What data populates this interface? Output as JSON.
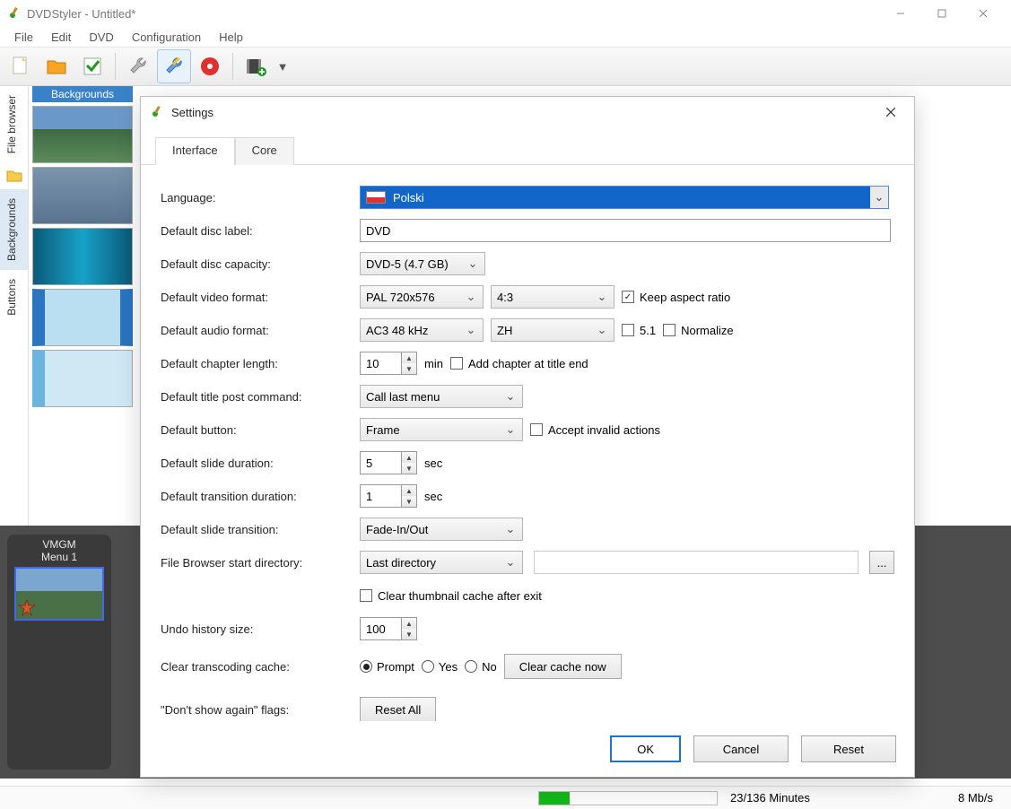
{
  "window": {
    "title": "DVDStyler - Untitled*"
  },
  "menubar": [
    "File",
    "Edit",
    "DVD",
    "Configuration",
    "Help"
  ],
  "toolbar_icons": [
    "new",
    "open",
    "save",
    "settings",
    "options",
    "burn",
    "sep",
    "add",
    "drop"
  ],
  "side_tabs": {
    "file_browser": "File browser",
    "backgrounds": "Backgrounds",
    "buttons": "Buttons"
  },
  "thumbs_header": "Backgrounds",
  "timeline": {
    "vmgm": "VMGM",
    "menu1": "Menu 1"
  },
  "status": {
    "minutes": "23/136 Minutes",
    "rate": "8 Mb/s",
    "progress_pct": 17
  },
  "dialog": {
    "title": "Settings",
    "tabs": {
      "interface": "Interface",
      "core": "Core"
    },
    "labels": {
      "language": "Language:",
      "disc_label": "Default disc label:",
      "disc_capacity": "Default disc capacity:",
      "video_format": "Default video format:",
      "audio_format": "Default audio format:",
      "chapter_length": "Default chapter length:",
      "title_post": "Default title post command:",
      "button": "Default button:",
      "slide_dur": "Default slide duration:",
      "trans_dur": "Default transition duration:",
      "slide_trans": "Default slide transition:",
      "start_dir": "File Browser start directory:",
      "undo": "Undo history size:",
      "clear_trans": "Clear transcoding cache:",
      "flags": "\"Don't show again\" flags:"
    },
    "values": {
      "language": "Polski",
      "disc_label": "DVD",
      "disc_capacity": "DVD-5 (4.7 GB)",
      "video_format": "PAL 720x576",
      "aspect": "4:3",
      "keep_aspect": true,
      "audio_format": "AC3 48 kHz",
      "audio_lang": "ZH",
      "five_one": false,
      "normalize": false,
      "chapter_length": "10",
      "chapter_unit": "min",
      "add_chapter_end": false,
      "title_post": "Call last menu",
      "button": "Frame",
      "accept_invalid": false,
      "slide_dur": "5",
      "slide_unit": "sec",
      "trans_dur": "1",
      "trans_unit": "sec",
      "slide_trans": "Fade-In/Out",
      "start_dir": "Last directory",
      "dir_path": "",
      "clear_thumb": false,
      "undo": "100",
      "clear_mode": "Prompt",
      "clear_yes": "Yes",
      "clear_no": "No"
    },
    "text": {
      "keep_aspect": "Keep aspect ratio",
      "five_one": "5.1",
      "normalize": "Normalize",
      "add_chapter_end": "Add chapter at title end",
      "accept_invalid": "Accept invalid actions",
      "clear_thumb": "Clear thumbnail cache after exit",
      "clear_cache_now": "Clear cache now",
      "reset_all": "Reset All",
      "browse": "...",
      "ok": "OK",
      "cancel": "Cancel",
      "reset": "Reset"
    }
  }
}
